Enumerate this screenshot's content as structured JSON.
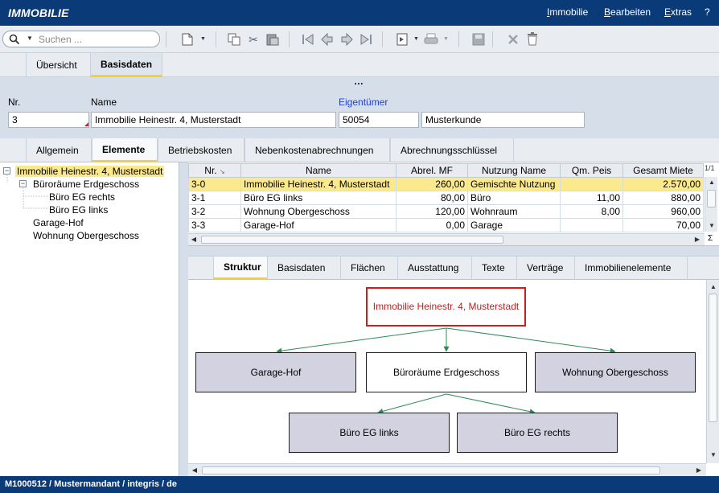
{
  "app": {
    "title": "IMMOBILIE"
  },
  "menu": [
    {
      "label": "Immobilie"
    },
    {
      "label": "Bearbeiten"
    },
    {
      "label": "Extras"
    },
    {
      "label": "?"
    }
  ],
  "toolbar": {
    "search_placeholder": "Suchen ...",
    "icons": [
      "search-icon",
      "new-document-icon",
      "copy-icon",
      "cut-icon",
      "paste-icon",
      "first-record-icon",
      "previous-record-icon",
      "next-record-icon",
      "last-record-icon",
      "report-icon",
      "print-icon",
      "save-icon",
      "cancel-icon",
      "delete-icon"
    ]
  },
  "top_tabs": [
    {
      "label": "Übersicht",
      "active": false
    },
    {
      "label": "Basisdaten",
      "active": true
    }
  ],
  "form": {
    "nr_label": "Nr.",
    "nr_value": "3",
    "name_label": "Name",
    "name_value": "Immobilie Heinestr. 4, Musterstadt",
    "owner_label": "Eigentümer",
    "owner_id": "50054",
    "owner_name": "Musterkunde"
  },
  "section_tabs": [
    {
      "label": "Allgemein"
    },
    {
      "label": "Elemente",
      "active": true
    },
    {
      "label": "Betriebskosten"
    },
    {
      "label": "Nebenkostenabrechnungen"
    },
    {
      "label": "Abrechnungsschlüssel"
    }
  ],
  "tree": {
    "root": "Immobilie Heinestr. 4, Musterstadt",
    "child1": "Büroräume Erdgeschoss",
    "child1a": "Büro EG rechts",
    "child1b": "Büro EG links",
    "child2": "Garage-Hof",
    "child3": "Wohnung Obergeschoss"
  },
  "grid": {
    "page": "1/1",
    "sigma": "Σ",
    "columns": [
      "Nr.",
      "Name",
      "Abrel. MF",
      "Nutzung Name",
      "Qm. Peis",
      "Gesamt Miete"
    ],
    "rows": [
      [
        "3-0",
        "Immobilie Heinestr. 4, Musterstadt",
        "260,00",
        "Gemischte Nutzung",
        "",
        "2.570,00"
      ],
      [
        "3-1",
        "Büro EG links",
        "80,00",
        "Büro",
        "11,00",
        "880,00"
      ],
      [
        "3-2",
        "Wohnung Obergeschoss",
        "120,00",
        "Wohnraum",
        "8,00",
        "960,00"
      ],
      [
        "3-3",
        "Garage-Hof",
        "0,00",
        "Garage",
        "",
        "70,00"
      ]
    ]
  },
  "lower_tabs": [
    {
      "label": "Struktur",
      "active": true
    },
    {
      "label": "Basisdaten"
    },
    {
      "label": "Flächen"
    },
    {
      "label": "Ausstattung"
    },
    {
      "label": "Texte"
    },
    {
      "label": "Verträge"
    },
    {
      "label": "Immobilienelemente"
    }
  ],
  "diagram": {
    "root": "Immobilie Heinestr. 4, Musterstadt",
    "level1_left": "Garage-Hof",
    "level1_mid": "Büroräume Erdgeschoss",
    "level1_right": "Wohnung Obergeschoss",
    "level2_left": "Büro EG links",
    "level2_right": "Büro EG rechts"
  },
  "status": {
    "text": "M1000512 / Mustermandant / integris / de"
  }
}
